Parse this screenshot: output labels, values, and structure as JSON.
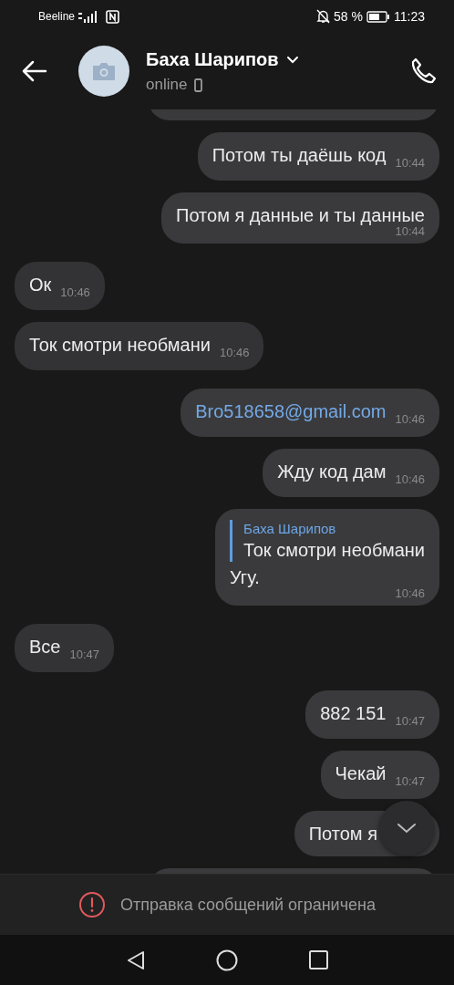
{
  "status_bar": {
    "carrier": "Beeline",
    "battery": "58 %",
    "time": "11:23"
  },
  "header": {
    "name": "Баха Шарипов",
    "status": "online"
  },
  "messages": [
    {
      "kind": "cut"
    },
    {
      "kind": "text",
      "outgoing": true,
      "text": "Потом ты даёшь код",
      "time": "10:44"
    },
    {
      "kind": "text",
      "outgoing": true,
      "text": "Потом я данные и ты данные",
      "time": "10:44",
      "time_below": true
    },
    {
      "kind": "text",
      "outgoing": false,
      "text": "Ок",
      "time": "10:46"
    },
    {
      "kind": "text",
      "outgoing": false,
      "text": "Ток смотри необмани",
      "time": "10:46"
    },
    {
      "kind": "link",
      "outgoing": true,
      "text": "Bro518658@gmail.com",
      "time": "10:46"
    },
    {
      "kind": "text",
      "outgoing": true,
      "text": "Жду код дам",
      "time": "10:46"
    },
    {
      "kind": "reply",
      "outgoing": true,
      "reply_author": "Баха Шарипов",
      "reply_text": "Ток смотри необмани",
      "text": "Угу.",
      "time": "10:46"
    },
    {
      "kind": "text",
      "outgoing": false,
      "text": "Все",
      "time": "10:47"
    },
    {
      "kind": "text",
      "outgoing": true,
      "text": "882 151",
      "time": "10:47"
    },
    {
      "kind": "text",
      "outgoing": true,
      "text": "Чекай",
      "time": "10:47"
    },
    {
      "kind": "text",
      "outgoing": true,
      "text": "Потом я"
    },
    {
      "kind": "cut"
    }
  ],
  "notice": "Отправка сообщений ограничена"
}
